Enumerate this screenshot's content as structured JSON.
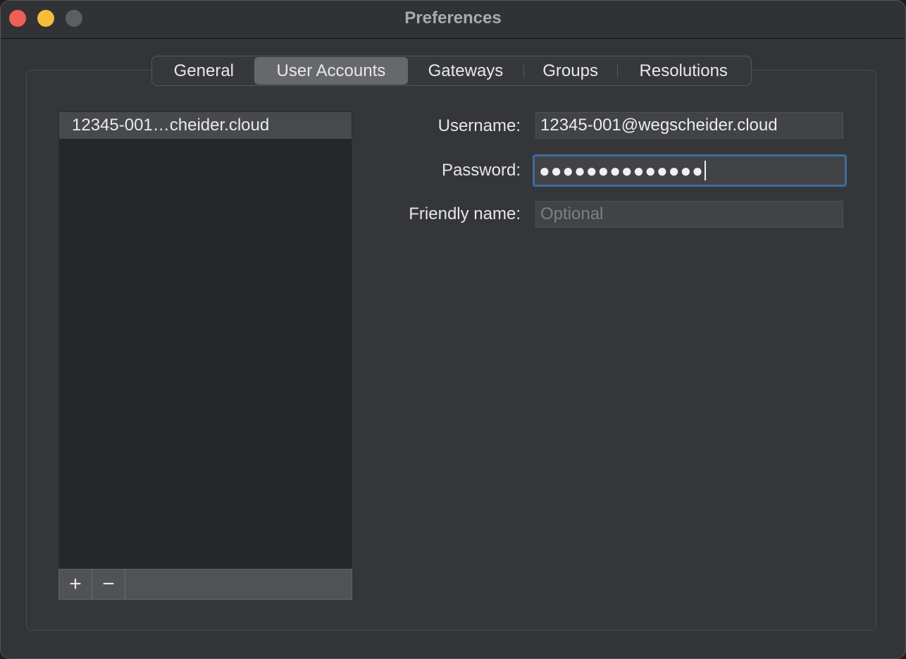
{
  "window": {
    "title": "Preferences"
  },
  "tabs": [
    {
      "label": "General",
      "active": false
    },
    {
      "label": "User Accounts",
      "active": true
    },
    {
      "label": "Gateways",
      "active": false
    },
    {
      "label": "Groups",
      "active": false
    },
    {
      "label": "Resolutions",
      "active": false
    }
  ],
  "accounts": {
    "items": [
      {
        "label": "12345-001…cheider.cloud",
        "selected": true
      }
    ],
    "add_label": "+",
    "remove_label": "−"
  },
  "form": {
    "username_label": "Username:",
    "username_value": "12345-001@wegscheider.cloud",
    "password_label": "Password:",
    "password_mask": "●●●●●●●●●●●●●●",
    "friendly_label": "Friendly name:",
    "friendly_value": "",
    "friendly_placeholder": "Optional"
  },
  "colors": {
    "close": "#ee5f57",
    "minimize": "#f6bd3b",
    "maximize": "#5d5e61",
    "focus_ring": "#3d6c9e",
    "active_tab": "#66686c"
  }
}
